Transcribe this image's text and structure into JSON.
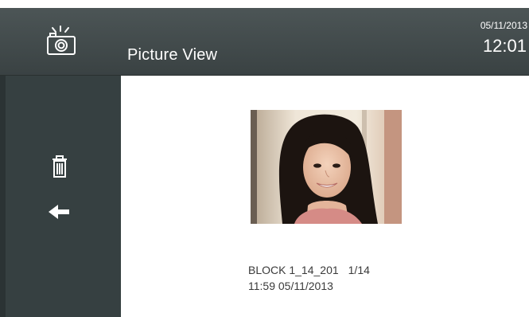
{
  "header": {
    "title": "Picture View",
    "date": "05/11/2013",
    "time": "12:01",
    "icon": "camera-icon"
  },
  "sidebar": {
    "delete_icon": "trash-icon",
    "back_icon": "back-arrow-icon"
  },
  "picture": {
    "name": "BLOCK 1_14_201",
    "count": "1/14",
    "timestamp": "11:59 05/11/2013"
  },
  "colors": {
    "header_bg": "#444d4e",
    "sidebar_bg": "#364041",
    "content_bg": "#ffffff",
    "text_light": "#ffffff",
    "text_dark": "#3a3a3a"
  }
}
